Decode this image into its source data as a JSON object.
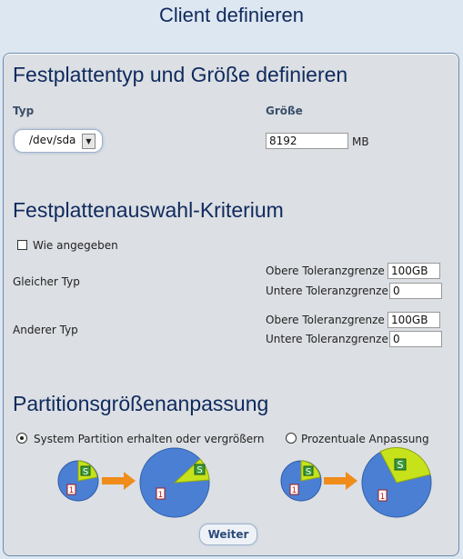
{
  "page": {
    "title": "Client definieren"
  },
  "disk_section": {
    "heading": "Festplattentyp und Größe definieren",
    "type_label": "Typ",
    "size_label": "Größe",
    "device_selected": "/dev/sda",
    "size_value": "8192",
    "size_unit": "MB"
  },
  "criteria_section": {
    "heading": "Festplattenauswahl-Kriterium",
    "as_given_label": "Wie angegeben",
    "same_type": {
      "label": "Gleicher Typ",
      "upper_label": "Obere Toleranzgrenze",
      "upper_value": "100GB",
      "lower_label": "Untere Toleranzgrenze",
      "lower_value": "0"
    },
    "other_type": {
      "label": "Anderer Typ",
      "upper_label": "Obere Toleranzgrenze",
      "upper_value": "100GB",
      "lower_label": "Untere Toleranzgrenze",
      "lower_value": "0"
    }
  },
  "partition_section": {
    "heading": "Partitionsgrößenanpassung",
    "option1_label": "System Partition erhalten oder vergrößern",
    "option2_label": "Prozentuale Anpassung",
    "selected_option": "option1",
    "icon_label_1": "1",
    "icon_label_s": "S"
  },
  "actions": {
    "next_label": "Weiter"
  },
  "colors": {
    "pie_blue": "#4a7fd4",
    "pie_green": "#c6e21a",
    "arrow": "#f08c1a",
    "heading": "#0f2a5e"
  }
}
